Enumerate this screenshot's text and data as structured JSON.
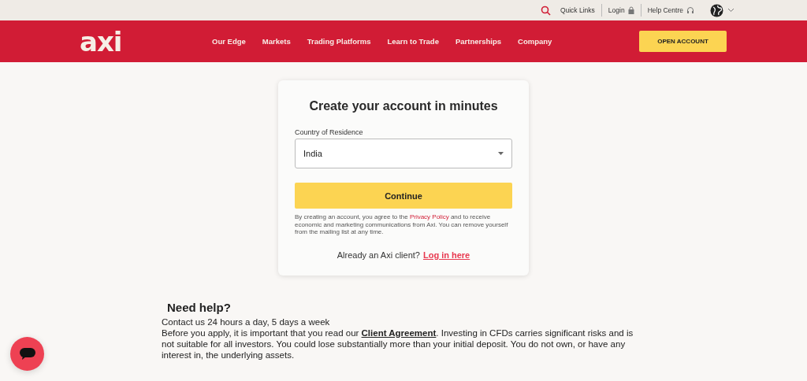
{
  "top_bar": {
    "quick_links": "Quick Links",
    "login": "Login",
    "help_centre": "Help Centre"
  },
  "nav": {
    "logo": "axi",
    "items": [
      "Our Edge",
      "Markets",
      "Trading Platforms",
      "Learn to Trade",
      "Partnerships",
      "Company"
    ],
    "cta": "OPEN ACCOUNT"
  },
  "card": {
    "title": "Create your account in minutes",
    "country_label": "Country of Residence",
    "country_value": "India",
    "continue": "Continue",
    "consent_before": "By creating an account, you agree to the ",
    "privacy_link": "Privacy Policy",
    "consent_after": " and to receive economic and marketing communications from Axi. You can remove yourself from the mailing list at any time.",
    "login_prompt": "Already an Axi client?",
    "login_link": "Log in here"
  },
  "help": {
    "title": "Need help?",
    "contact": "Contact us 24 hours a day, 5 days a week",
    "disclaimer_before": "Before you apply, it is important that you read our ",
    "agreement_link": "Client Agreement",
    "disclaimer_after": ". Investing in CFDs carries significant risks and is not suitable for all investors. You could lose substantially more than your initial deposit. You do not own, or have any interest in, the underlying assets."
  }
}
